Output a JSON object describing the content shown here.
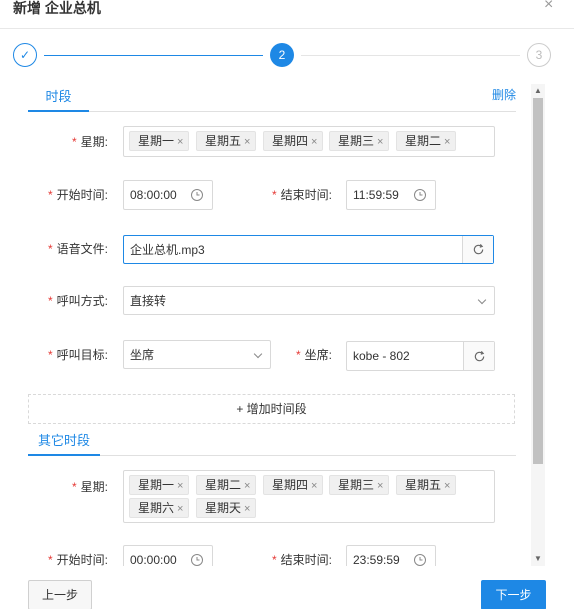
{
  "modal": {
    "title": "新增 企业总机",
    "close_glyph": "×"
  },
  "steps": [
    {
      "label": "✓",
      "state": "done"
    },
    {
      "label": "2",
      "state": "active"
    },
    {
      "label": "3",
      "state": "pending"
    }
  ],
  "section1": {
    "tab": "时段",
    "delete": "删除",
    "weekday_label": "星期:",
    "weekdays": [
      "星期一",
      "星期五",
      "星期四",
      "星期三",
      "星期二"
    ],
    "start_label": "开始时间:",
    "start_value": "08:00:00",
    "end_label": "结束时间:",
    "end_value": "11:59:59",
    "audio_label": "语音文件:",
    "audio_value": "企业总机.mp3",
    "call_mode_label": "呼叫方式:",
    "call_mode_value": "直接转",
    "call_target_label": "呼叫目标:",
    "call_target_value": "坐席",
    "seat_label": "坐席:",
    "seat_value": "kobe - 802"
  },
  "add_range": "+ 增加时间段",
  "section2": {
    "tab": "其它时段",
    "weekday_label": "星期:",
    "weekdays": [
      "星期一",
      "星期二",
      "星期四",
      "星期三",
      "星期五",
      "星期六",
      "星期天"
    ],
    "start_label": "开始时间:",
    "start_value": "00:00:00",
    "end_label": "结束时间:",
    "end_value": "23:59:59"
  },
  "footer": {
    "prev": "上一步",
    "next": "下一步"
  },
  "tag_remove_glyph": "×",
  "required_mark": "*",
  "colors": {
    "accent": "#1e88e5",
    "required": "#e53935"
  }
}
